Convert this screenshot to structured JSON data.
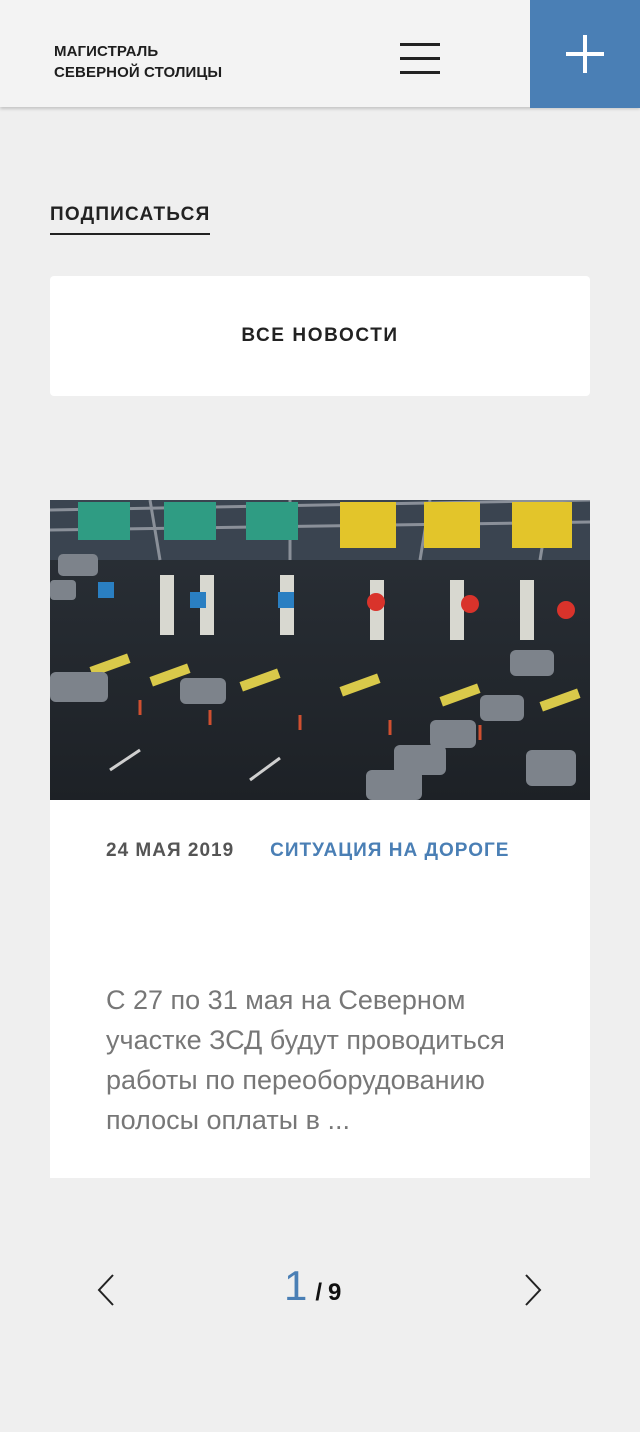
{
  "header": {
    "logo_line1": "МАГИСТРАЛЬ",
    "logo_line2": "СЕВЕРНОЙ СТОЛИЦЫ",
    "accent_color": "#4a7fb5"
  },
  "subscribe_label": "ПОДПИСАТЬСЯ",
  "all_news_label": "ВСЕ НОВОСТИ",
  "news_card": {
    "date": "24 МАЯ 2019",
    "category": "СИТУАЦИЯ НА ДОРОГЕ",
    "excerpt": "С 27 по 31 мая на Северном участке ЗСД будут проводиться работы по переоборудованию полосы оплаты в ..."
  },
  "pagination": {
    "current": "1",
    "separator": "/",
    "total": "9"
  },
  "icons": {
    "menu": "hamburger-menu-icon",
    "add": "plus-icon",
    "prev": "chevron-left-icon",
    "next": "chevron-right-icon"
  }
}
